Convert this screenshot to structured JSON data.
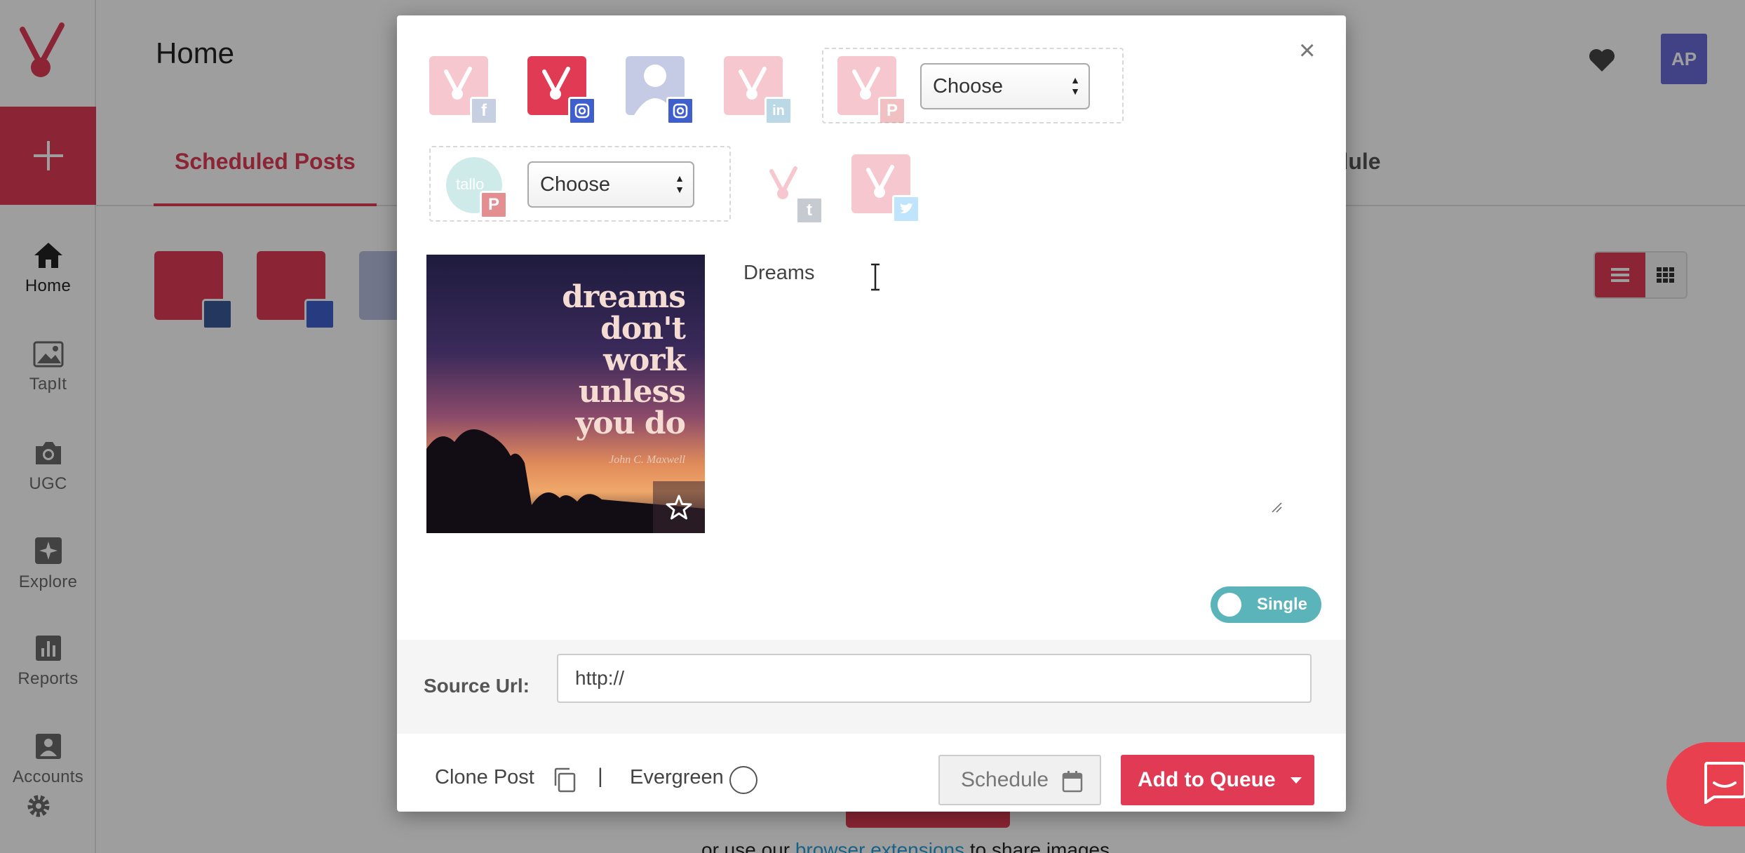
{
  "sidebar": {
    "items": [
      {
        "label": "Home"
      },
      {
        "label": "TapIt"
      },
      {
        "label": "UGC"
      },
      {
        "label": "Explore"
      },
      {
        "label": "Reports"
      },
      {
        "label": "Accounts"
      }
    ]
  },
  "header": {
    "title": "Home",
    "avatar_initials": "AP"
  },
  "tabs": {
    "scheduled": "Scheduled Posts",
    "schedule_partial": "edule"
  },
  "background_footer": {
    "prefix": "or use our ",
    "link": "browser extensions",
    "suffix": " to share images"
  },
  "modal": {
    "choose_pinterest_board": "Choose",
    "choose_second_board": "Choose",
    "tallo_avatar_text": "tallo",
    "image_quote": "dreams\ndon't\nwork\nunless\nyou do",
    "image_quote_author": "John C. Maxwell",
    "caption": "Dreams",
    "toggle_label": "Single",
    "source_url_label": "Source Url:",
    "source_url_value": "http://",
    "clone_post_label": "Clone Post",
    "pipe": "|",
    "evergreen_label": "Evergreen",
    "schedule_label": "Schedule",
    "add_to_queue_label": "Add to Queue",
    "close_symbol": "×"
  },
  "colors": {
    "brand": "#e03a55",
    "toggle": "#5ab4ba",
    "avatar": "#6a6ad8",
    "facebook": "#3b5998",
    "instagram": "#3f5fcf",
    "linkedin": "#0e76a8",
    "pinterest": "#cb2027",
    "tumblr": "#35465c",
    "twitter": "#1da1f2"
  }
}
